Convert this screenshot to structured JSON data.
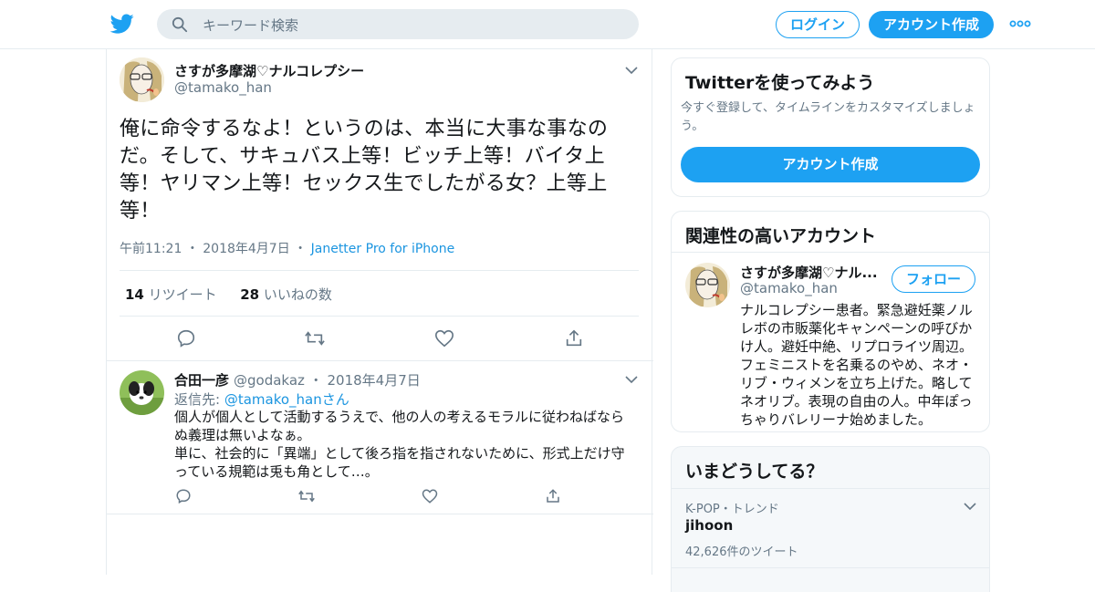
{
  "header": {
    "search_placeholder": "キーワード検索",
    "login_label": "ログイン",
    "signup_label": "アカウント作成",
    "brand_color": "#1da1f2"
  },
  "tweet": {
    "author_name": "さすが多摩湖♡ナルコレプシー",
    "author_handle": "@tamako_han",
    "text": "俺に命令するなよ！というのは、本当に大事な事なのだ。そして、サキュバス上等！ビッチ上等！バイタ上等！ヤリマン上等！セックス生でしたがる女？上等上等！",
    "time": "午前11:21",
    "date": "2018年4月7日",
    "source": "Janetter Pro for iPhone",
    "retweet_count": "14",
    "retweet_label": "リツイート",
    "like_count": "28",
    "like_label": "いいねの数"
  },
  "reply": {
    "author_name": "合田一彦",
    "author_handle": "@godakaz",
    "date": "2018年4月7日",
    "reply_to_label": "返信先:",
    "reply_to_handle": "@tamako_han",
    "reply_to_suffix": "さん",
    "text_line1": "個人が個人として活動するうえで、他の人の考えるモラルに従わねばならぬ義理は無いよなぁ。",
    "text_line2": "単に、社会的に「異端」として後ろ指を指されないために、形式上だけ守っている規範は兎も角として…。"
  },
  "sidebar": {
    "signup_card": {
      "title": "Twitterを使ってみよう",
      "description": "今すぐ登録して、タイムラインをカスタマイズしましょう。",
      "button_label": "アカウント作成"
    },
    "related_card": {
      "title": "関連性の高いアカウント",
      "name": "さすが多摩湖♡ナル...",
      "handle": "@tamako_han",
      "follow_label": "フォロー",
      "bio": "ナルコレプシー患者。緊急避妊薬ノルレボの市販薬化キャンペーンの呼びかけ人。避妊中絶、リプロライツ周辺。フェミニストを名乗るのやめ、ネオ・リブ・ウィメンを立ち上げた。略してネオリブ。表現の自由の人。中年ぽっちゃりバレリーナ始めました。"
    },
    "trends_card": {
      "title": "いまどうしてる？",
      "trend_meta": "K-POP・トレンド",
      "trend_name": "jihoon",
      "trend_count": "42,626件のツイート"
    }
  }
}
